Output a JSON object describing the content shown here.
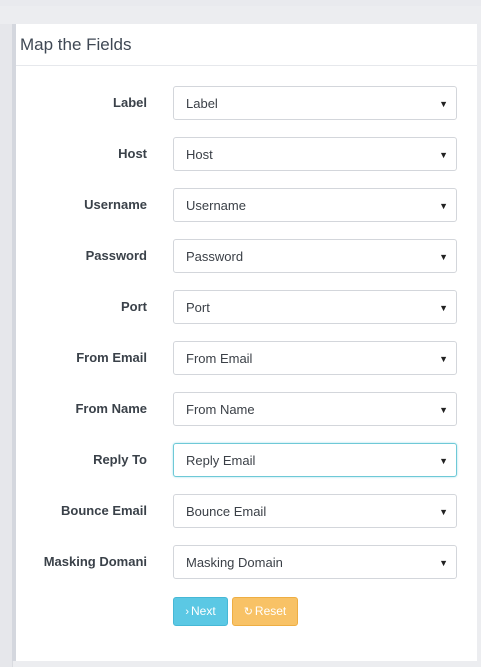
{
  "panel": {
    "title": "Map the Fields"
  },
  "fields": [
    {
      "label": "Label",
      "value": "Label"
    },
    {
      "label": "Host",
      "value": "Host"
    },
    {
      "label": "Username",
      "value": "Username"
    },
    {
      "label": "Password",
      "value": "Password"
    },
    {
      "label": "Port",
      "value": "Port"
    },
    {
      "label": "From Email",
      "value": "From Email"
    },
    {
      "label": "From Name",
      "value": "From Name"
    },
    {
      "label": "Reply To",
      "value": "Reply Email",
      "focused": true
    },
    {
      "label": "Bounce Email",
      "value": "Bounce Email"
    },
    {
      "label": "Masking Domani",
      "value": "Masking Domain"
    }
  ],
  "buttons": {
    "next": {
      "label": "Next",
      "icon": "chevron-right-icon",
      "color": "#5bc8e4"
    },
    "reset": {
      "label": "Reset",
      "icon": "refresh-icon",
      "color": "#f8c266"
    }
  },
  "colors": {
    "focus_border": "#6ec9d7"
  }
}
